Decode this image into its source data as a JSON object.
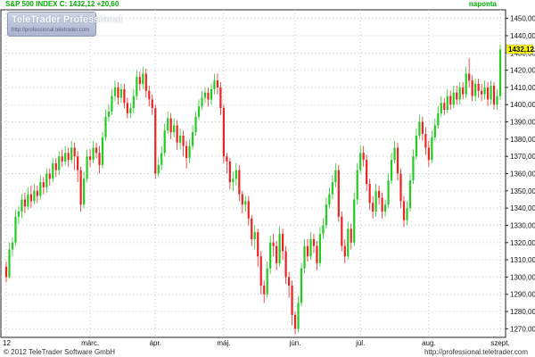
{
  "header": {
    "symbol_label": "S&P 500 INDEX C: 1432,12 +20,60",
    "period_label": "naponta"
  },
  "logo": {
    "title": "TeleTrader Professional",
    "url": "http://professional.teletrader.com"
  },
  "footer": {
    "copyright": "© 2012 TeleTrader Software GmbH",
    "url": "http://professional.teletrader.com"
  },
  "colors": {
    "up": "#22cc22",
    "down": "#ee2222",
    "last_price_bg": "#ffff00",
    "grid": "#c8c8c8"
  },
  "chart_data": {
    "type": "candlestick",
    "ylim": [
      1265,
      1455
    ],
    "y_ticks": [
      1270,
      1280,
      1290,
      1300,
      1310,
      1320,
      1330,
      1340,
      1350,
      1360,
      1370,
      1380,
      1390,
      1400,
      1410,
      1420,
      1430,
      1440,
      1450
    ],
    "y_tick_labels": [
      "1270,00",
      "1280,00",
      "1290,00",
      "1300,00",
      "1310,00",
      "1320,00",
      "1330,00",
      "1340,00",
      "1350,00",
      "1360,00",
      "1370,00",
      "1380,00",
      "1390,00",
      "1400,00",
      "1410,00",
      "1420,00",
      "1430,00",
      "1440,00",
      "1450,00"
    ],
    "x_tick_labels": [
      "12",
      "márc.",
      "ápr.",
      "máj.",
      "jún.",
      "júl.",
      "aug.",
      "szept."
    ],
    "x_tick_index": [
      0,
      27,
      48,
      70,
      93,
      114,
      136,
      159
    ],
    "last_price": 1432.12,
    "last_price_label": "1432,12",
    "candles": [
      [
        1306,
        1300,
        1309,
        1297
      ],
      [
        1300,
        1316,
        1320,
        1299
      ],
      [
        1316,
        1320,
        1323,
        1312
      ],
      [
        1320,
        1335,
        1339,
        1318
      ],
      [
        1335,
        1338,
        1341,
        1331
      ],
      [
        1338,
        1345,
        1348,
        1334
      ],
      [
        1345,
        1341,
        1349,
        1337
      ],
      [
        1341,
        1348,
        1352,
        1339
      ],
      [
        1348,
        1344,
        1353,
        1340
      ],
      [
        1344,
        1350,
        1354,
        1342
      ],
      [
        1350,
        1347,
        1353,
        1343
      ],
      [
        1347,
        1355,
        1359,
        1345
      ],
      [
        1355,
        1352,
        1358,
        1348
      ],
      [
        1352,
        1360,
        1363,
        1349
      ],
      [
        1360,
        1357,
        1363,
        1353
      ],
      [
        1357,
        1366,
        1369,
        1355
      ],
      [
        1366,
        1362,
        1369,
        1358
      ],
      [
        1362,
        1370,
        1373,
        1359
      ],
      [
        1370,
        1367,
        1374,
        1364
      ],
      [
        1367,
        1372,
        1376,
        1365
      ],
      [
        1372,
        1368,
        1375,
        1364
      ],
      [
        1368,
        1375,
        1379,
        1366
      ],
      [
        1375,
        1370,
        1378,
        1362
      ],
      [
        1370,
        1362,
        1373,
        1355
      ],
      [
        1362,
        1342,
        1364,
        1338
      ],
      [
        1342,
        1357,
        1361,
        1340
      ],
      [
        1357,
        1370,
        1374,
        1355
      ],
      [
        1370,
        1368,
        1374,
        1364
      ],
      [
        1368,
        1375,
        1379,
        1366
      ],
      [
        1375,
        1372,
        1378,
        1369
      ],
      [
        1372,
        1365,
        1376,
        1360
      ],
      [
        1365,
        1381,
        1384,
        1363
      ],
      [
        1381,
        1393,
        1397,
        1379
      ],
      [
        1393,
        1396,
        1400,
        1390
      ],
      [
        1396,
        1405,
        1409,
        1394
      ],
      [
        1405,
        1410,
        1414,
        1402
      ],
      [
        1410,
        1404,
        1413,
        1400
      ],
      [
        1404,
        1409,
        1412,
        1401
      ],
      [
        1409,
        1401,
        1412,
        1398
      ],
      [
        1401,
        1395,
        1404,
        1392
      ],
      [
        1395,
        1398,
        1401,
        1392
      ],
      [
        1398,
        1405,
        1409,
        1395
      ],
      [
        1405,
        1416,
        1420,
        1403
      ],
      [
        1416,
        1412,
        1419,
        1408
      ],
      [
        1412,
        1418,
        1422,
        1409
      ],
      [
        1418,
        1408,
        1421,
        1404
      ],
      [
        1408,
        1403,
        1411,
        1399
      ],
      [
        1403,
        1398,
        1406,
        1394
      ],
      [
        1398,
        1360,
        1400,
        1357
      ],
      [
        1360,
        1365,
        1369,
        1358
      ],
      [
        1365,
        1372,
        1376,
        1362
      ],
      [
        1372,
        1385,
        1389,
        1370
      ],
      [
        1385,
        1392,
        1396,
        1383
      ],
      [
        1392,
        1384,
        1395,
        1380
      ],
      [
        1384,
        1388,
        1392,
        1381
      ],
      [
        1388,
        1378,
        1391,
        1374
      ],
      [
        1378,
        1382,
        1386,
        1374
      ],
      [
        1382,
        1376,
        1385,
        1370
      ],
      [
        1376,
        1369,
        1379,
        1363
      ],
      [
        1369,
        1376,
        1380,
        1366
      ],
      [
        1376,
        1384,
        1388,
        1374
      ],
      [
        1384,
        1393,
        1396,
        1382
      ],
      [
        1393,
        1399,
        1403,
        1391
      ],
      [
        1399,
        1404,
        1408,
        1397
      ],
      [
        1404,
        1407,
        1410,
        1401
      ],
      [
        1407,
        1403,
        1410,
        1399
      ],
      [
        1403,
        1409,
        1412,
        1400
      ],
      [
        1409,
        1414,
        1418,
        1406
      ],
      [
        1414,
        1410,
        1418,
        1406
      ],
      [
        1410,
        1398,
        1413,
        1394
      ],
      [
        1398,
        1370,
        1400,
        1366
      ],
      [
        1370,
        1367,
        1372,
        1360
      ],
      [
        1367,
        1355,
        1369,
        1351
      ],
      [
        1355,
        1357,
        1361,
        1350
      ],
      [
        1357,
        1362,
        1366,
        1353
      ],
      [
        1362,
        1348,
        1365,
        1344
      ],
      [
        1348,
        1342,
        1350,
        1337
      ],
      [
        1342,
        1344,
        1347,
        1338
      ],
      [
        1344,
        1334,
        1347,
        1330
      ],
      [
        1334,
        1322,
        1336,
        1318
      ],
      [
        1322,
        1326,
        1330,
        1316
      ],
      [
        1326,
        1312,
        1328,
        1306
      ],
      [
        1312,
        1295,
        1315,
        1290
      ],
      [
        1295,
        1290,
        1298,
        1285
      ],
      [
        1290,
        1305,
        1309,
        1288
      ],
      [
        1305,
        1320,
        1324,
        1302
      ],
      [
        1320,
        1318,
        1325,
        1312
      ],
      [
        1318,
        1308,
        1321,
        1304
      ],
      [
        1308,
        1325,
        1329,
        1306
      ],
      [
        1325,
        1315,
        1328,
        1310
      ],
      [
        1315,
        1300,
        1318,
        1296
      ],
      [
        1300,
        1295,
        1303,
        1288
      ],
      [
        1295,
        1278,
        1298,
        1272
      ],
      [
        1278,
        1270,
        1280,
        1267
      ],
      [
        1270,
        1285,
        1289,
        1268
      ],
      [
        1285,
        1305,
        1308,
        1283
      ],
      [
        1305,
        1318,
        1322,
        1302
      ],
      [
        1318,
        1312,
        1322,
        1309
      ],
      [
        1312,
        1322,
        1326,
        1310
      ],
      [
        1322,
        1318,
        1325,
        1314
      ],
      [
        1318,
        1308,
        1321,
        1304
      ],
      [
        1308,
        1325,
        1329,
        1306
      ],
      [
        1325,
        1330,
        1334,
        1322
      ],
      [
        1330,
        1342,
        1346,
        1328
      ],
      [
        1342,
        1348,
        1352,
        1340
      ],
      [
        1348,
        1355,
        1359,
        1345
      ],
      [
        1355,
        1362,
        1366,
        1352
      ],
      [
        1362,
        1335,
        1365,
        1332
      ],
      [
        1335,
        1318,
        1338,
        1315
      ],
      [
        1318,
        1312,
        1322,
        1308
      ],
      [
        1312,
        1328,
        1332,
        1310
      ],
      [
        1328,
        1320,
        1331,
        1316
      ],
      [
        1320,
        1345,
        1349,
        1318
      ],
      [
        1345,
        1362,
        1366,
        1342
      ],
      [
        1362,
        1372,
        1376,
        1360
      ],
      [
        1372,
        1368,
        1376,
        1364
      ],
      [
        1368,
        1354,
        1371,
        1350
      ],
      [
        1354,
        1343,
        1357,
        1339
      ],
      [
        1343,
        1338,
        1347,
        1334
      ],
      [
        1338,
        1350,
        1354,
        1335
      ],
      [
        1350,
        1346,
        1353,
        1342
      ],
      [
        1346,
        1338,
        1349,
        1334
      ],
      [
        1338,
        1342,
        1345,
        1335
      ],
      [
        1342,
        1356,
        1360,
        1340
      ],
      [
        1356,
        1368,
        1372,
        1354
      ],
      [
        1368,
        1375,
        1379,
        1366
      ],
      [
        1375,
        1360,
        1378,
        1356
      ],
      [
        1360,
        1344,
        1363,
        1340
      ],
      [
        1344,
        1333,
        1347,
        1329
      ],
      [
        1333,
        1340,
        1344,
        1330
      ],
      [
        1340,
        1356,
        1360,
        1338
      ],
      [
        1356,
        1370,
        1374,
        1354
      ],
      [
        1370,
        1382,
        1386,
        1368
      ],
      [
        1382,
        1390,
        1394,
        1380
      ],
      [
        1390,
        1383,
        1393,
        1379
      ],
      [
        1383,
        1375,
        1387,
        1371
      ],
      [
        1375,
        1368,
        1379,
        1364
      ],
      [
        1368,
        1381,
        1385,
        1366
      ],
      [
        1381,
        1388,
        1392,
        1379
      ],
      [
        1388,
        1395,
        1399,
        1386
      ],
      [
        1395,
        1401,
        1405,
        1393
      ],
      [
        1401,
        1397,
        1404,
        1394
      ],
      [
        1397,
        1405,
        1409,
        1395
      ],
      [
        1405,
        1400,
        1408,
        1397
      ],
      [
        1400,
        1407,
        1411,
        1398
      ],
      [
        1407,
        1403,
        1411,
        1400
      ],
      [
        1403,
        1410,
        1413,
        1400
      ],
      [
        1410,
        1406,
        1413,
        1403
      ],
      [
        1406,
        1418,
        1422,
        1404
      ],
      [
        1418,
        1414,
        1427,
        1410
      ],
      [
        1414,
        1405,
        1417,
        1402
      ],
      [
        1405,
        1412,
        1415,
        1402
      ],
      [
        1412,
        1408,
        1415,
        1404
      ],
      [
        1408,
        1406,
        1412,
        1402
      ],
      [
        1406,
        1410,
        1414,
        1403
      ],
      [
        1410,
        1403,
        1413,
        1399
      ],
      [
        1403,
        1411,
        1414,
        1400
      ],
      [
        1411,
        1400,
        1413,
        1397
      ],
      [
        1400,
        1405,
        1409,
        1397
      ],
      [
        1405,
        1432,
        1435,
        1403
      ]
    ]
  }
}
